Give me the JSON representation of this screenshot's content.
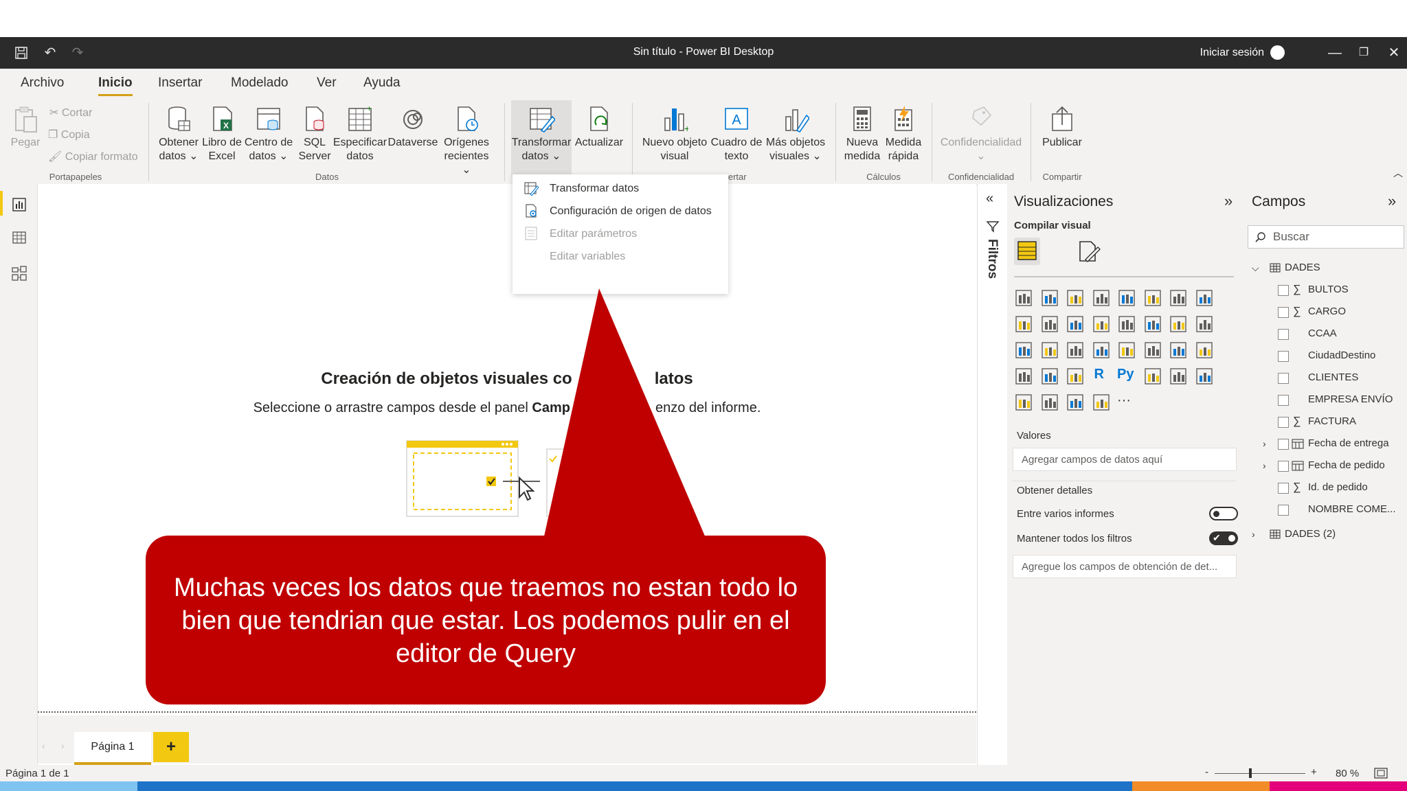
{
  "window": {
    "title": "Sin título - Power BI Desktop",
    "signin": "Iniciar sesión"
  },
  "menu": {
    "tabs": [
      "Archivo",
      "Inicio",
      "Insertar",
      "Modelado",
      "Ver",
      "Ayuda"
    ],
    "active": "Inicio"
  },
  "ribbon": {
    "clipboard": {
      "paste": "Pegar",
      "cut": "Cortar",
      "copy": "Copia",
      "format_painter": "Copiar formato",
      "group": "Portapapeles"
    },
    "data": {
      "get_data": [
        "Obtener",
        "datos ⌄"
      ],
      "excel": [
        "Libro de",
        "Excel"
      ],
      "hub": [
        "Centro de",
        "datos ⌄"
      ],
      "sql": [
        "SQL",
        "Server"
      ],
      "enter": [
        "Especificar",
        "datos"
      ],
      "dataverse": [
        "Dataverse",
        ""
      ],
      "recent": [
        "Orígenes",
        "recientes ⌄"
      ],
      "group": "Datos"
    },
    "queries": {
      "transform": [
        "Transformar",
        "datos ⌄"
      ],
      "refresh": [
        "Actualizar",
        ""
      ]
    },
    "insert": {
      "new_visual": [
        "Nuevo objeto",
        "visual"
      ],
      "text_box": [
        "Cuadro de",
        "texto"
      ],
      "more_visuals": [
        "Más objetos",
        "visuales ⌄"
      ],
      "group": "sertar"
    },
    "calc": {
      "new_measure": [
        "Nueva",
        "medida"
      ],
      "quick_measure": [
        "Medida",
        "rápida"
      ],
      "group": "Cálculos"
    },
    "sensitivity": {
      "label": "Confidencialidad",
      "group": "Confidencialidad"
    },
    "share": {
      "publish": "Publicar",
      "group": "Compartir"
    }
  },
  "dropdown": {
    "items": [
      {
        "label": "Transformar datos",
        "enabled": true
      },
      {
        "label": "Configuración de origen de datos",
        "enabled": true
      },
      {
        "label": "Editar parámetros",
        "enabled": false
      },
      {
        "label": "Editar variables",
        "enabled": false
      }
    ]
  },
  "canvas": {
    "placeholder_title": "Creación de objetos visuales co",
    "placeholder_title_end": "latos",
    "placeholder_sub_start": "Seleccione o arrastre campos desde el panel",
    "placeholder_sub_bold": "Camp",
    "placeholder_sub_end": "enzo del informe."
  },
  "callout": {
    "text": "Muchas veces los datos que traemos no estan todo lo bien que tendrian que estar. Los podemos pulir en el editor de Query",
    "color": "#c00000"
  },
  "filters": {
    "label": "Filtros"
  },
  "visualizations": {
    "title": "Visualizaciones",
    "build_label": "Compilar visual",
    "values_label": "Valores",
    "values_placeholder": "Agregar campos de datos aquí",
    "drill_label": "Obtener detalles",
    "cross_report": "Entre varios informes",
    "cross_report_on": false,
    "keep_filters": "Mantener todos los filtros",
    "keep_filters_on": true,
    "drill_placeholder": "Agregue los campos de obtención de det...",
    "r_icon": "R",
    "py_icon": "Py",
    "more_icon": "···"
  },
  "fields": {
    "title": "Campos",
    "search_placeholder": "Buscar",
    "table": "DADES",
    "items": [
      {
        "name": "BULTOS",
        "sigma": true,
        "expand": false,
        "calendar": false
      },
      {
        "name": "CARGO",
        "sigma": true,
        "expand": false,
        "calendar": false
      },
      {
        "name": "CCAA",
        "sigma": false,
        "expand": false,
        "calendar": false
      },
      {
        "name": "CiudadDestino",
        "sigma": false,
        "expand": false,
        "calendar": false
      },
      {
        "name": "CLIENTES",
        "sigma": false,
        "expand": false,
        "calendar": false
      },
      {
        "name": "EMPRESA ENVÍO",
        "sigma": false,
        "expand": false,
        "calendar": false
      },
      {
        "name": "FACTURA",
        "sigma": true,
        "expand": false,
        "calendar": false
      },
      {
        "name": "Fecha de entrega",
        "sigma": false,
        "expand": true,
        "calendar": true
      },
      {
        "name": "Fecha de pedido",
        "sigma": false,
        "expand": true,
        "calendar": true
      },
      {
        "name": "Id. de pedido",
        "sigma": true,
        "expand": false,
        "calendar": false
      },
      {
        "name": "NOMBRE COME...",
        "sigma": false,
        "expand": false,
        "calendar": false
      }
    ],
    "table2": "DADES (2)"
  },
  "pages": {
    "tab": "Página 1",
    "add": "+"
  },
  "status": {
    "page": "Página 1 de 1",
    "zoom": "80 %",
    "minus": "-",
    "plus": "+"
  },
  "colors": {
    "accent": "#f2c811",
    "underline": "#d4a017",
    "callout": "#c00000"
  }
}
